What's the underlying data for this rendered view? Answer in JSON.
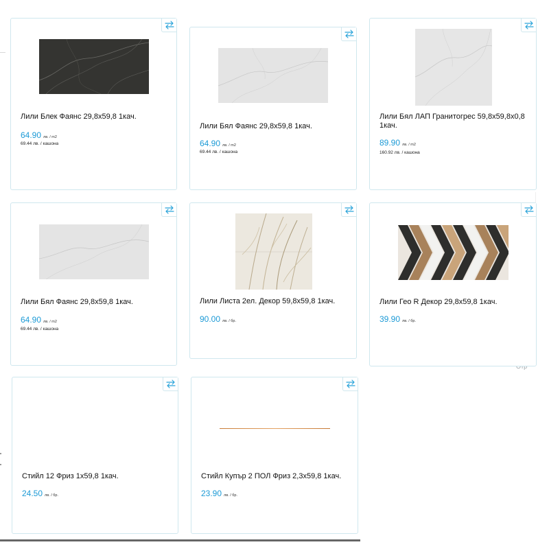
{
  "products": [
    {
      "title": "Лили Блек Фаянс 29,8x59,8 1кач.",
      "price": "64.90",
      "unit": "лв. / m2",
      "box_price": "69.44 лв. / кашона"
    },
    {
      "title": "Лили Бял Фаянс 29,8x59,8 1кач.",
      "price": "64.90",
      "unit": "лв. / m2",
      "box_price": "69.44 лв. / кашона"
    },
    {
      "title": "Лили Бял ЛАП Гранитогрес 59,8x59,8x0,8 1кач.",
      "price": "89.90",
      "unit": "лв. / m2",
      "box_price": "160.92 лв. / кашона"
    },
    {
      "title": "Лили Бял Фаянс 29,8x59,8 1кач.",
      "price": "64.90",
      "unit": "лв. / m2",
      "box_price": "69.44 лв. / кашона"
    },
    {
      "title": "Лили Листа 2ел. Декор 59,8x59,8 1кач.",
      "price": "90.00",
      "unit": "лв. / бр."
    },
    {
      "title": "Лили Гео R Декор 29,8x59,8 1кач.",
      "price": "39.90",
      "unit": "лв. / бр."
    },
    {
      "title": "Стийл 12 Фриз 1x59,8 1кач.",
      "price": "24.50",
      "unit": "лв. / бр."
    },
    {
      "title": "Стийл Купър 2 ПОЛ Фриз 2,3x59,8 1кач.",
      "price": "23.90",
      "unit": "лв. / бр."
    }
  ],
  "page": {
    "right_hint": "Отр"
  },
  "icons": {
    "compare": "compare-arrows-icon"
  },
  "colors": {
    "price": "#1c9ad6",
    "border": "#cfe7ee"
  }
}
